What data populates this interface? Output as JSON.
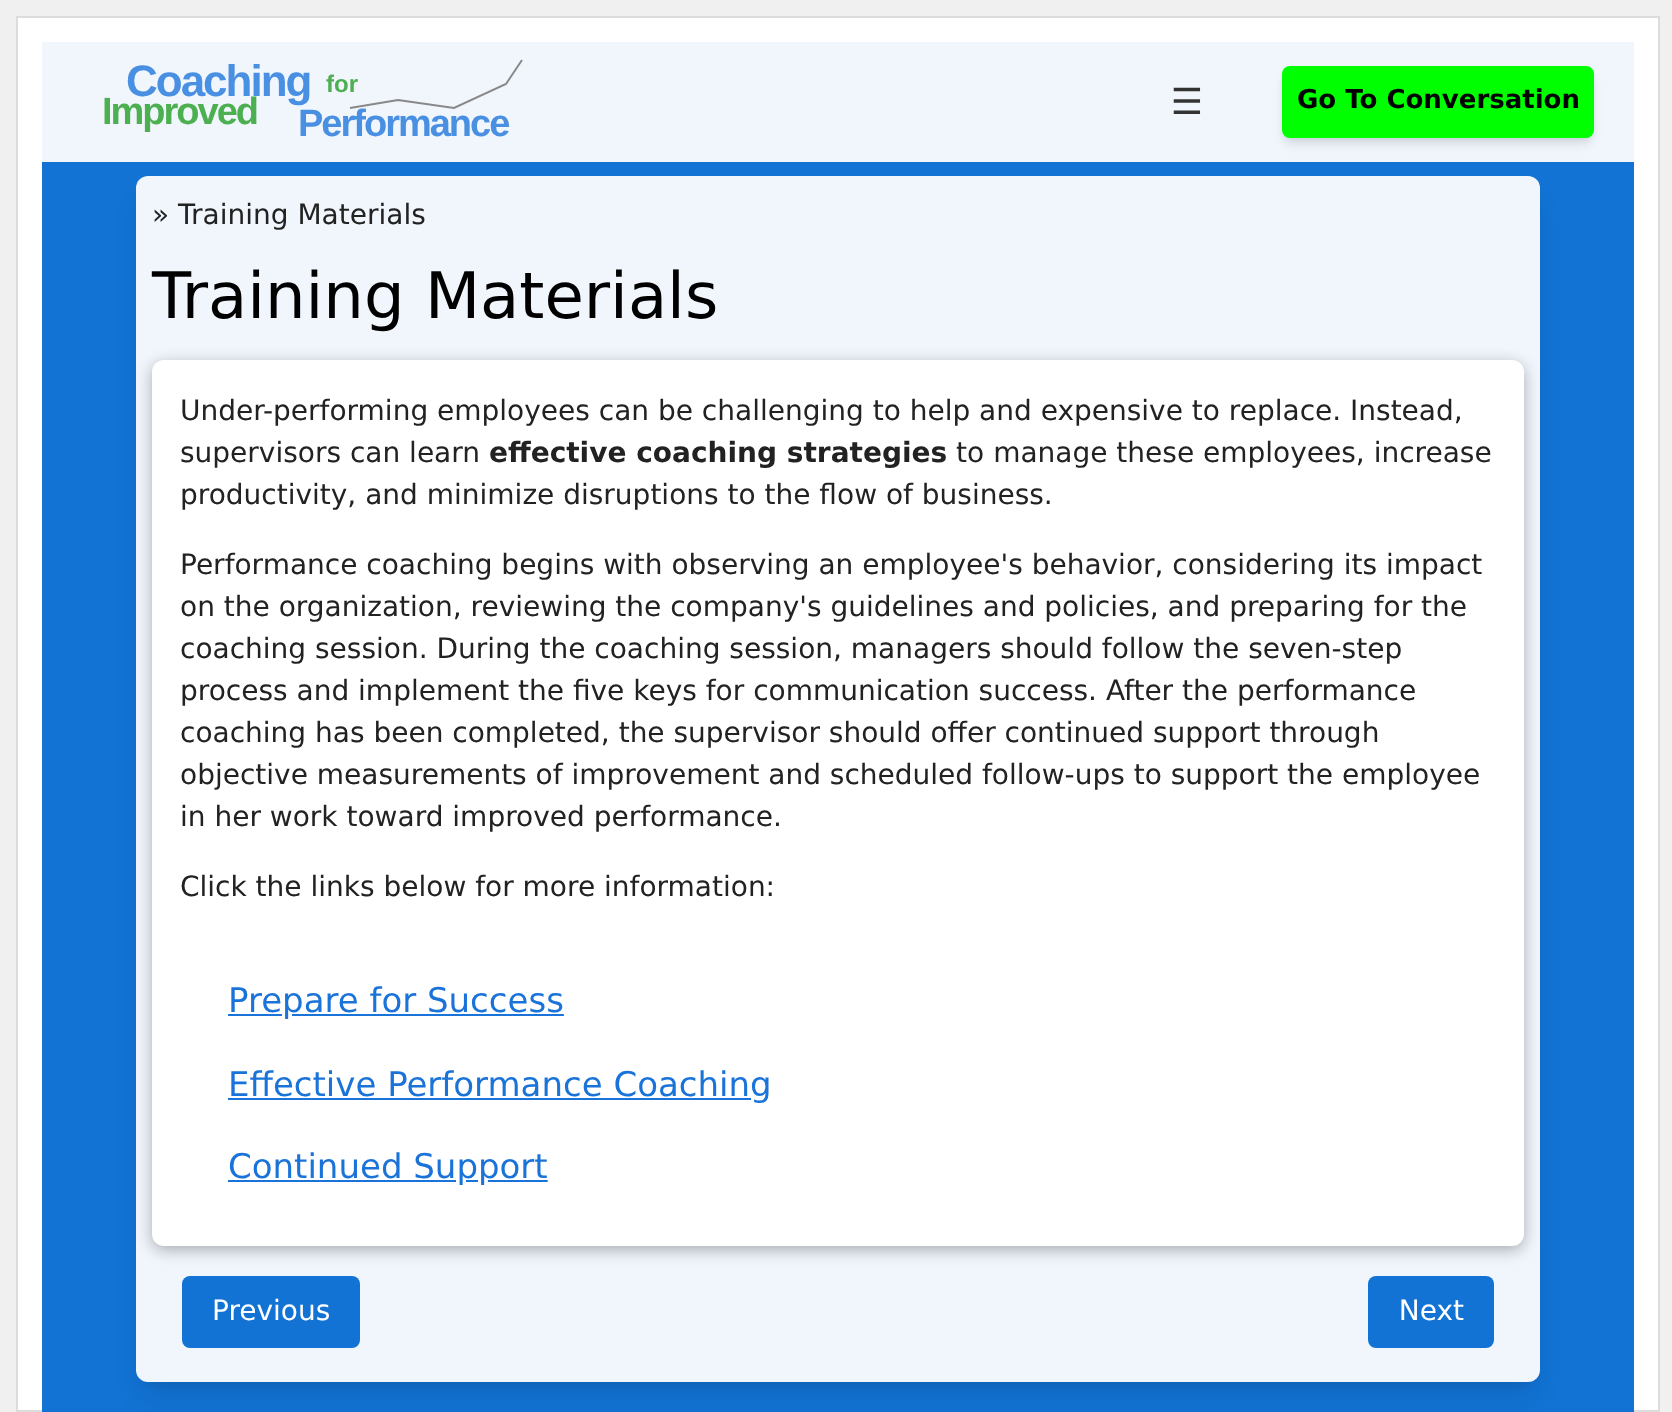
{
  "header": {
    "logo": {
      "words": [
        "Coaching",
        "for",
        "Improved",
        "Performance"
      ]
    },
    "menu_glyph": "☰",
    "cta_button": "Go To Conversation"
  },
  "breadcrumb": "» Training Materials",
  "title": "Training Materials",
  "paragraphs": [
    "Under-performing employees can be challenging to help and expensive to replace. Instead, supervisors can learn **effective coaching strategies** to manage these employees, increase productivity, and minimize disruptions to the flow of business.",
    "Performance coaching begins with observing an employee's behavior, considering its impact on the organization, reviewing the company's guidelines and policies, and preparing for the coaching session. During the coaching session, managers should follow the seven-step process and implement the five keys for communication success. After the performance coaching has been completed, the supervisor should offer continued support through objective measurements of improvement and scheduled follow-ups to support the employee in her work toward improved performance.",
    "Click the links below for more information:"
  ],
  "links": [
    "Prepare for Success",
    "Effective Performance Coaching",
    "Continued Support"
  ],
  "nav": {
    "previous": "Previous",
    "next": "Next"
  }
}
